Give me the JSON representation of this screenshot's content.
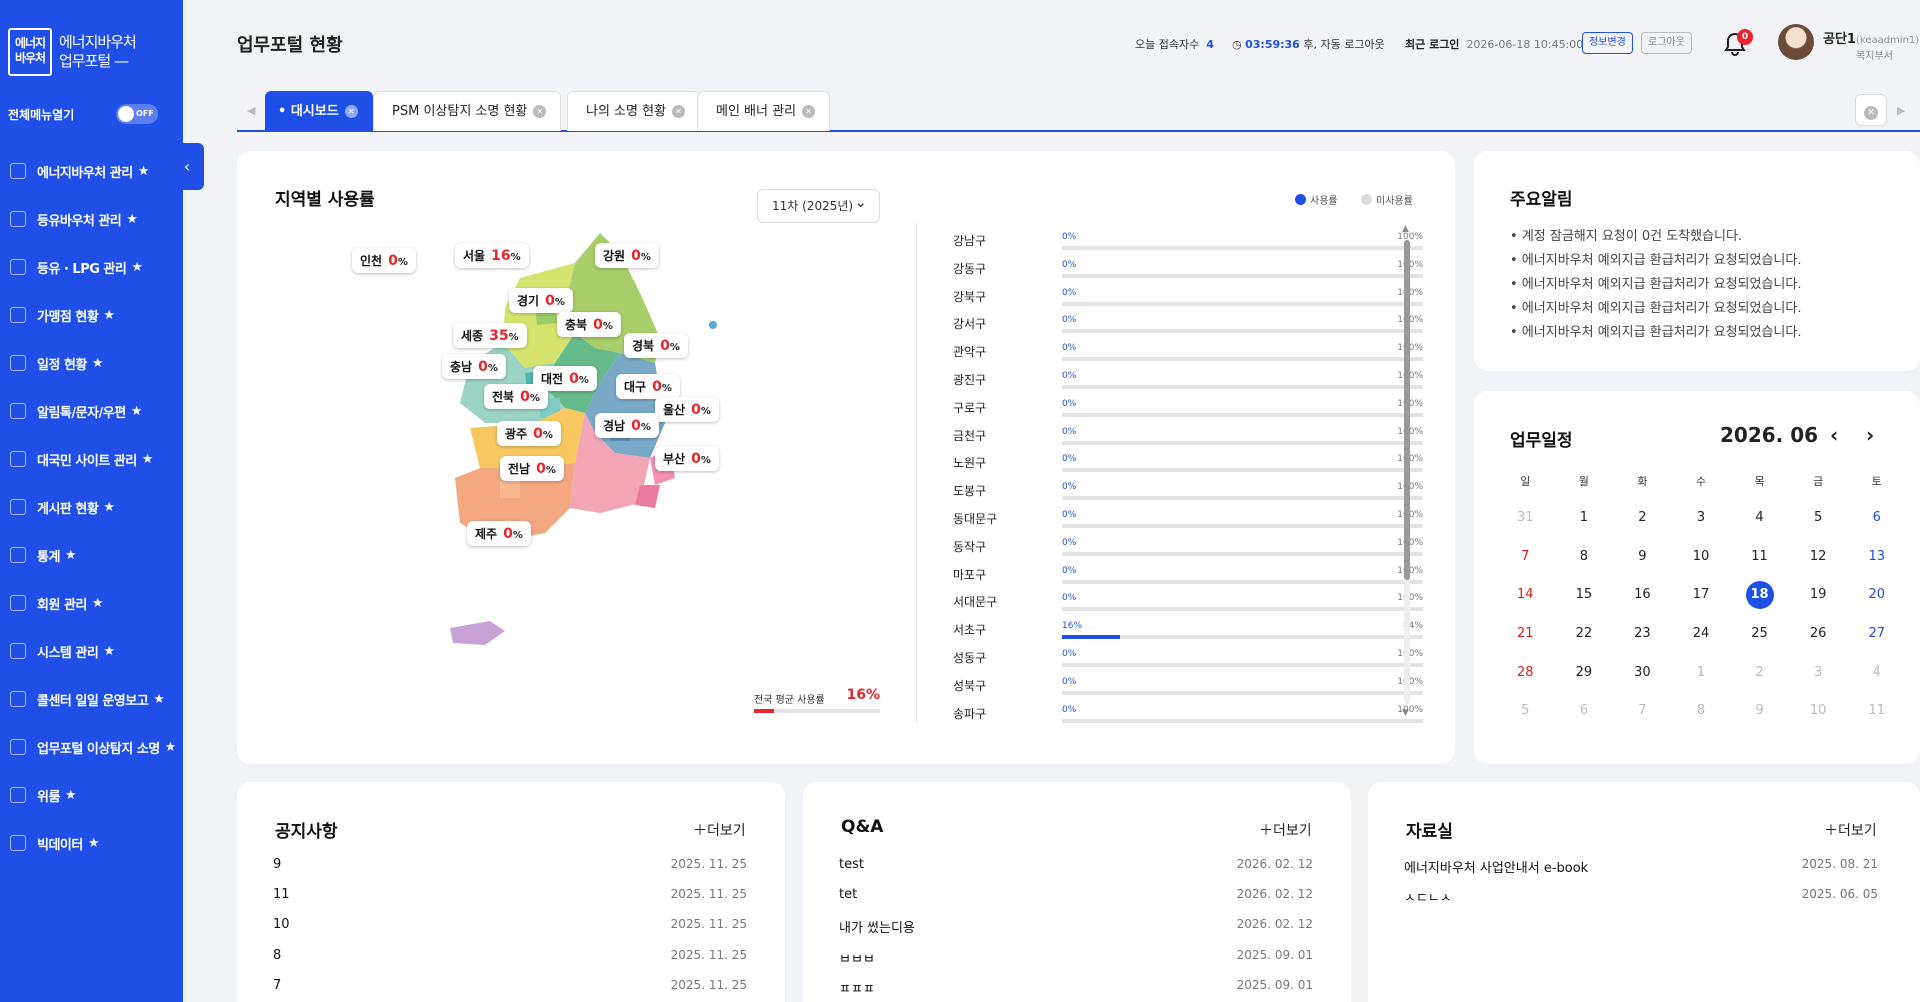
{
  "sidebar": {
    "logo_line1": "에너지",
    "logo_line2": "바우처",
    "logo_text1": "에너지바우처",
    "logo_text2": "업무포털",
    "toggle_label": "전체메뉴열기",
    "toggle_state": "OFF",
    "items": [
      "에너지바우처 관리",
      "등유바우처 관리",
      "등유 · LPG 관리",
      "가맹점 현황",
      "일정 현황",
      "알림톡/문자/우편",
      "대국민 사이트 관리",
      "게시판 현황",
      "통계",
      "회원 관리",
      "시스템 관리",
      "콜센터 일일 운영보고",
      "업무포털 이상탐지 소명",
      "위룸",
      "빅데이터"
    ]
  },
  "header": {
    "title": "업무포털 현황",
    "visitors_label": "오늘 접속자수",
    "visitors": "4",
    "timer": "03:59:36",
    "timer_suffix": "후, 자동 로그아웃",
    "last_login_label": "최근 로그인",
    "last_login": "2026-06-18 10:45:00",
    "info_btn": "정보변경",
    "logout_btn": "로그아웃",
    "bell_count": "0",
    "user_name": "공단1",
    "user_id": "(keaadmin1)",
    "user_dept": "복지부서"
  },
  "tabs": [
    {
      "label": "대시보드",
      "active": true
    },
    {
      "label": "PSM 이상탐지 소명 현황"
    },
    {
      "label": "나의 소명 현황"
    },
    {
      "label": "메인 배너 관리"
    }
  ],
  "regional": {
    "title": "지역별 사용률",
    "select": "11차 (2025년)",
    "legend_used": "사용률",
    "legend_unused": "미사용률",
    "avg_label": "전국 평균 사용률",
    "avg_value": "16",
    "avg_unit": "%",
    "avg_fraction": 0.16,
    "regions": [
      {
        "name": "인천",
        "value": "0"
      },
      {
        "name": "서울",
        "value": "16"
      },
      {
        "name": "강원",
        "value": "0"
      },
      {
        "name": "경기",
        "value": "0"
      },
      {
        "name": "세종",
        "value": "35"
      },
      {
        "name": "충북",
        "value": "0"
      },
      {
        "name": "경북",
        "value": "0"
      },
      {
        "name": "충남",
        "value": "0"
      },
      {
        "name": "대전",
        "value": "0"
      },
      {
        "name": "대구",
        "value": "0"
      },
      {
        "name": "전북",
        "value": "0"
      },
      {
        "name": "울산",
        "value": "0"
      },
      {
        "name": "광주",
        "value": "0"
      },
      {
        "name": "경남",
        "value": "0"
      },
      {
        "name": "부산",
        "value": "0"
      },
      {
        "name": "전남",
        "value": "0"
      },
      {
        "name": "제주",
        "value": "0"
      }
    ],
    "districts": [
      {
        "name": "강남구",
        "used": "0%",
        "unused": "100%",
        "f": 0
      },
      {
        "name": "강동구",
        "used": "0%",
        "unused": "100%",
        "f": 0
      },
      {
        "name": "강북구",
        "used": "0%",
        "unused": "100%",
        "f": 0
      },
      {
        "name": "강서구",
        "used": "0%",
        "unused": "100%",
        "f": 0
      },
      {
        "name": "관악구",
        "used": "0%",
        "unused": "100%",
        "f": 0
      },
      {
        "name": "광진구",
        "used": "0%",
        "unused": "100%",
        "f": 0
      },
      {
        "name": "구로구",
        "used": "0%",
        "unused": "100%",
        "f": 0
      },
      {
        "name": "금천구",
        "used": "0%",
        "unused": "100%",
        "f": 0
      },
      {
        "name": "노원구",
        "used": "0%",
        "unused": "100%",
        "f": 0
      },
      {
        "name": "도봉구",
        "used": "0%",
        "unused": "100%",
        "f": 0
      },
      {
        "name": "동대문구",
        "used": "0%",
        "unused": "100%",
        "f": 0
      },
      {
        "name": "동작구",
        "used": "0%",
        "unused": "100%",
        "f": 0
      },
      {
        "name": "마포구",
        "used": "0%",
        "unused": "100%",
        "f": 0
      },
      {
        "name": "서대문구",
        "used": "0%",
        "unused": "100%",
        "f": 0
      },
      {
        "name": "서초구",
        "used": "16%",
        "unused": "84%",
        "f": 0.16
      },
      {
        "name": "성동구",
        "used": "0%",
        "unused": "100%",
        "f": 0
      },
      {
        "name": "성북구",
        "used": "0%",
        "unused": "100%",
        "f": 0
      },
      {
        "name": "송파구",
        "used": "0%",
        "unused": "100%",
        "f": 0
      }
    ]
  },
  "alerts": {
    "title": "주요알림",
    "items": [
      "계정 잠금해지 요청이 0건 도착했습니다.",
      "에너지바우처 예외지급 환급처리가 요청되었습니다.",
      "에너지바우처 예외지급 환급처리가 요청되었습니다.",
      "에너지바우처 예외지급 환급처리가 요청되었습니다.",
      "에너지바우처 예외지급 환급처리가 요청되었습니다."
    ]
  },
  "calendar": {
    "title": "업무일정",
    "month": "2026. 06",
    "weekdays": [
      "일",
      "월",
      "화",
      "수",
      "목",
      "금",
      "토"
    ],
    "days": [
      "31",
      "1",
      "2",
      "3",
      "4",
      "5",
      "6",
      "7",
      "8",
      "9",
      "10",
      "11",
      "12",
      "13",
      "14",
      "15",
      "16",
      "17",
      "18",
      "19",
      "20",
      "21",
      "22",
      "23",
      "24",
      "25",
      "26",
      "27",
      "28",
      "29",
      "30",
      "1",
      "2",
      "3",
      "4",
      "5",
      "6",
      "7",
      "8",
      "9",
      "10",
      "11"
    ],
    "today": "18"
  },
  "notice": {
    "title": "공지사항",
    "more": "더보기",
    "rows": [
      {
        "t": "9",
        "d": "2025. 11. 25"
      },
      {
        "t": "11",
        "d": "2025. 11. 25"
      },
      {
        "t": "10",
        "d": "2025. 11. 25"
      },
      {
        "t": "8",
        "d": "2025. 11. 25"
      },
      {
        "t": "7",
        "d": "2025. 11. 25"
      }
    ]
  },
  "qna": {
    "title": "Q&A",
    "more": "더보기",
    "rows": [
      {
        "t": "test",
        "d": "2026. 02. 12"
      },
      {
        "t": "tet",
        "d": "2026. 02. 12"
      },
      {
        "t": "내가 썼는디용",
        "d": "2026. 02. 12"
      },
      {
        "t": "ㅂㅂㅂ",
        "d": "2025. 09. 01"
      },
      {
        "t": "ㅍㅍㅍ",
        "d": "2025. 09. 01"
      }
    ]
  },
  "archive": {
    "title": "자료실",
    "more": "더보기",
    "rows": [
      {
        "t": "에너지바우처 사업안내서 e-book",
        "d": "2025. 08. 21"
      },
      {
        "t": "ㅅㄷㄴㅅ",
        "d": "2025. 06. 05"
      }
    ]
  }
}
